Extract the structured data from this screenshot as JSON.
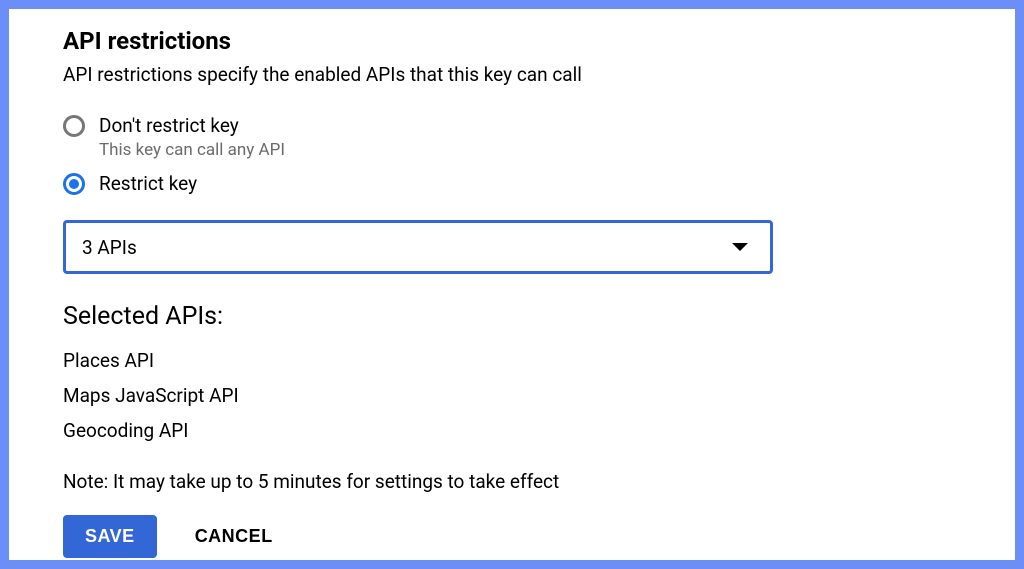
{
  "section": {
    "title": "API restrictions",
    "description": "API restrictions specify the enabled APIs that this key can call"
  },
  "radios": {
    "dont_restrict": {
      "label": "Don't restrict key",
      "sublabel": "This key can call any API",
      "selected": false
    },
    "restrict": {
      "label": "Restrict key",
      "selected": true
    }
  },
  "dropdown": {
    "selected_text": "3 APIs"
  },
  "selected_apis": {
    "title": "Selected APIs:",
    "items": [
      "Places API",
      "Maps JavaScript API",
      "Geocoding API"
    ]
  },
  "note": "Note: It may take up to 5 minutes for settings to take effect",
  "buttons": {
    "save": "SAVE",
    "cancel": "CANCEL"
  },
  "colors": {
    "frame_border": "#6b8ff7",
    "primary": "#3367d6",
    "radio_selected": "#1a73e8",
    "text_muted": "#6b6b6b"
  }
}
